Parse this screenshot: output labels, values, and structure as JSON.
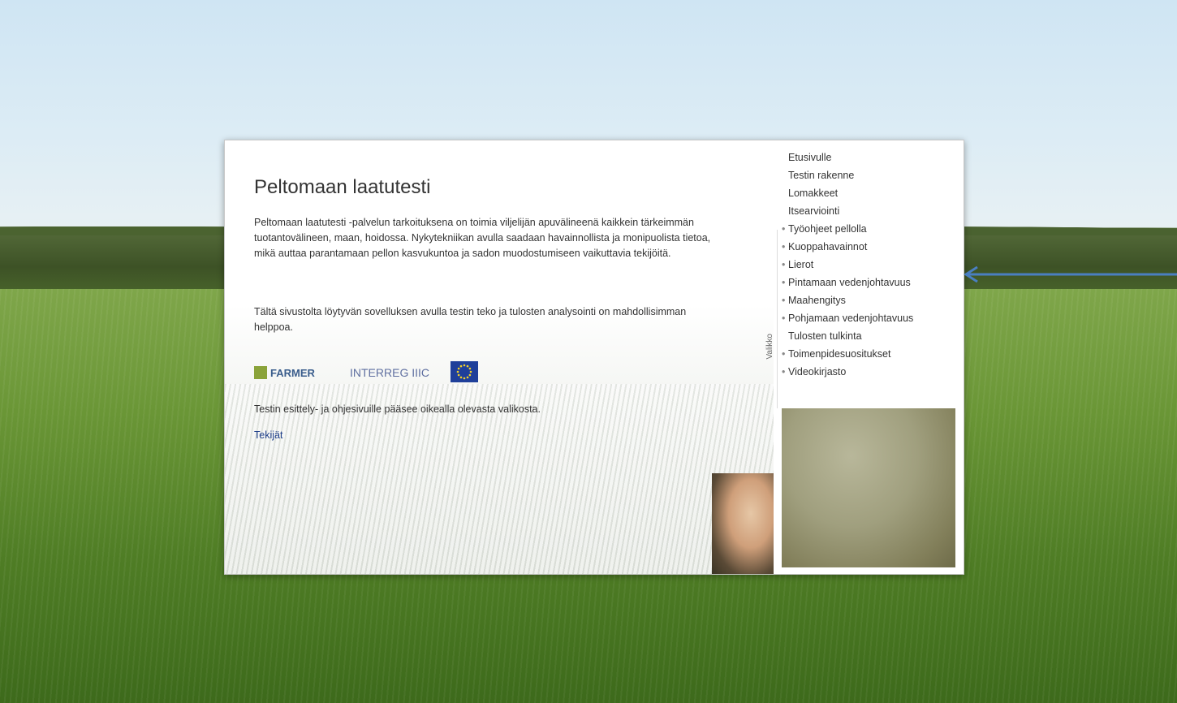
{
  "page": {
    "title": "Peltomaan laatutesti",
    "intro": "Peltomaan laatutesti -palvelun tarkoituksena on toimia viljelijän apuvälineenä kaikkein tärkeimmän tuotantovälineen, maan, hoidossa. Nykytekniikan avulla saadaan havainnollista ja monipuolista tietoa, mikä auttaa parantamaan pellon kasvukuntoa ja sadon muodostumiseen vaikuttavia tekijöitä.",
    "usage": "Tältä sivustolta löytyvän sovelluksen avulla testin teko ja tulosten analysointi on mahdollisimman helppoa.",
    "navigation_hint": "Testin esittely- ja ohjesivuille pääsee oikealla olevasta valikosta.",
    "authors_link": "Tekijät"
  },
  "logos": {
    "farmer": "FARMER",
    "interreg": "INTERREG IIIC",
    "eu": "eu-flag-icon"
  },
  "menu": {
    "label": "Valikko",
    "items": [
      {
        "label": "Etusivulle",
        "bullet": false
      },
      {
        "label": "Testin rakenne",
        "bullet": false
      },
      {
        "label": "Lomakkeet",
        "bullet": false
      },
      {
        "label": "Itsearviointi",
        "bullet": false
      },
      {
        "label": "Työohjeet pellolla",
        "bullet": true
      },
      {
        "label": "Kuoppahavainnot",
        "bullet": true
      },
      {
        "label": "Lierot",
        "bullet": true
      },
      {
        "label": "Pintamaan vedenjohtavuus",
        "bullet": true
      },
      {
        "label": "Maahengitys",
        "bullet": true
      },
      {
        "label": "Pohjamaan vedenjohtavuus",
        "bullet": true
      },
      {
        "label": "Tulosten tulkinta",
        "bullet": false
      },
      {
        "label": "Toimenpidesuositukset",
        "bullet": true
      },
      {
        "label": "Videokirjasto",
        "bullet": true
      }
    ],
    "bullet_glyph": "•"
  },
  "annotation": {
    "arrow_color": "#4a7fc1"
  }
}
